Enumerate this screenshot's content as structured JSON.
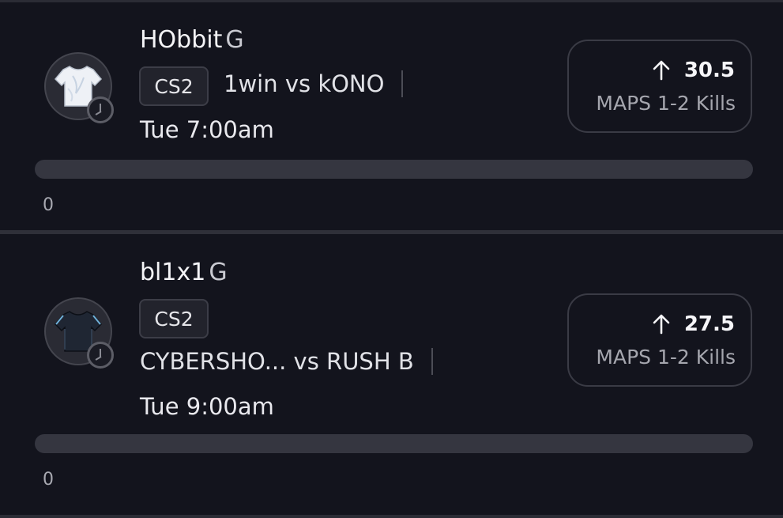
{
  "picks": [
    {
      "player": "HObbit",
      "position": "G",
      "game": "CS2",
      "matchup": "1win vs kONO",
      "time": "Tue 7:00am",
      "direction_icon": "arrow-up-icon",
      "line": "30.5",
      "stat": "MAPS 1-2 Kills",
      "jersey_color": "#e9edf3",
      "progress_value": 0,
      "progress_label": "0"
    },
    {
      "player": "bl1x1",
      "position": "G",
      "game": "CS2",
      "matchup": "CYBERSHO... vs RUSH B",
      "time": "Tue 9:00am",
      "direction_icon": "arrow-up-icon",
      "line": "27.5",
      "stat": "MAPS 1-2 Kills",
      "jersey_color": "#1d2330",
      "progress_value": 0,
      "progress_label": "0"
    }
  ]
}
